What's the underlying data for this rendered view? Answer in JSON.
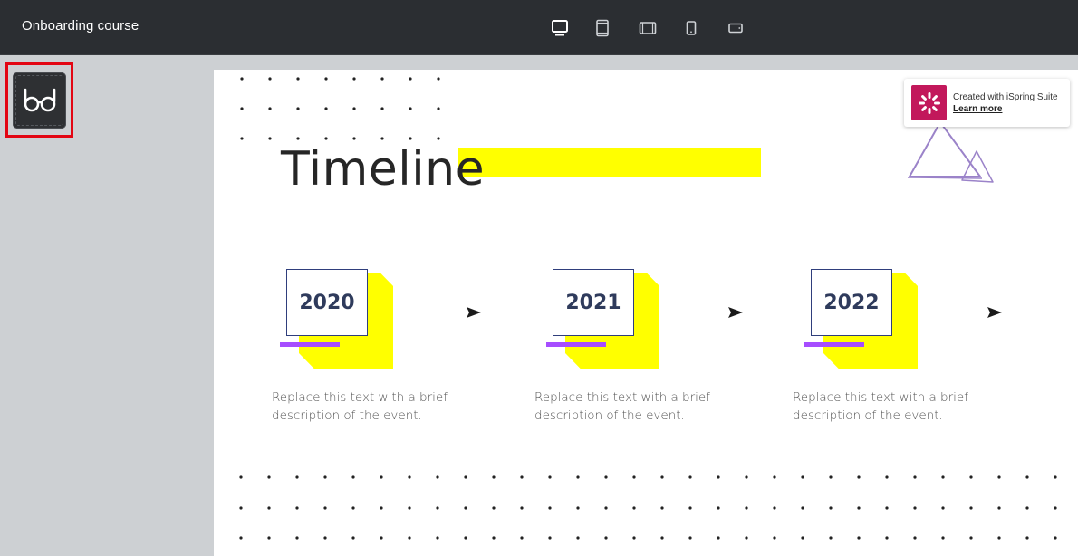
{
  "topbar": {
    "title": "Onboarding course",
    "devices": [
      {
        "name": "desktop-view",
        "active": true
      },
      {
        "name": "tablet-portrait-view",
        "active": false
      },
      {
        "name": "tablet-landscape-view",
        "active": false
      },
      {
        "name": "phone-portrait-view",
        "active": false
      },
      {
        "name": "phone-landscape-view",
        "active": false
      }
    ]
  },
  "focus_button": {
    "icon": "glasses-icon"
  },
  "slide": {
    "title": "Timeline",
    "badge": {
      "line1": "Created with iSpring Suite",
      "link": "Learn more"
    },
    "events": [
      {
        "year": "2020",
        "description": "Replace this text with a brief description of the event."
      },
      {
        "year": "2021",
        "description": "Replace this text with a brief description of the event."
      },
      {
        "year": "2022",
        "description": "Replace this text with a brief description of the event."
      }
    ]
  },
  "colors": {
    "topbar_bg": "#2b2e32",
    "highlight_yellow": "#ffff00",
    "accent_purple": "#a64dff",
    "year_text": "#2f3b5c",
    "ispring_brand": "#c2185b",
    "focus_border": "#e30613"
  }
}
